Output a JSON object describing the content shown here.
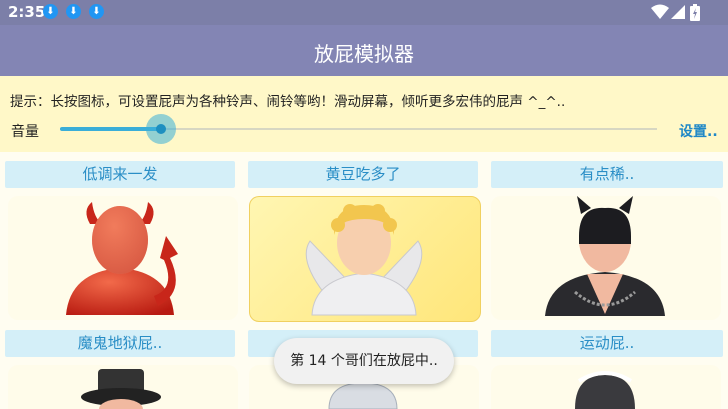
{
  "status": {
    "time": "2:35",
    "download_icons": [
      "download-icon",
      "download-icon",
      "download-icon"
    ]
  },
  "app": {
    "title": "放屁模拟器"
  },
  "info": {
    "hint": "提示：长按图标，可设置屁声为各种铃声、闹铃等哟！滑动屏幕，倾听更多宏伟的屁声 ^_^..",
    "volume_label": "音量",
    "volume_value": 0.17,
    "settings_label": "设置.."
  },
  "grid": [
    {
      "label": "低调来一发",
      "icon": "devil-avatar-icon",
      "selected": false
    },
    {
      "label": "黄豆吃多了",
      "icon": "angel-avatar-icon",
      "selected": true
    },
    {
      "label": "有点稀..",
      "icon": "catwoman-avatar-icon",
      "selected": false
    },
    {
      "label": "魔鬼地狱屁..",
      "icon": "top-hat-avatar-icon",
      "selected": false
    },
    {
      "label": "",
      "icon": "helmet-avatar-icon",
      "selected": false
    },
    {
      "label": "运动屁..",
      "icon": "maid-avatar-icon",
      "selected": false
    }
  ],
  "toast": {
    "text": "第 14 个哥们在放屁中.."
  },
  "colors": {
    "app_bar": "#8385b4",
    "info_bg": "#fff8c8",
    "accent": "#3aaed8",
    "label_text": "#2a8ec6"
  }
}
